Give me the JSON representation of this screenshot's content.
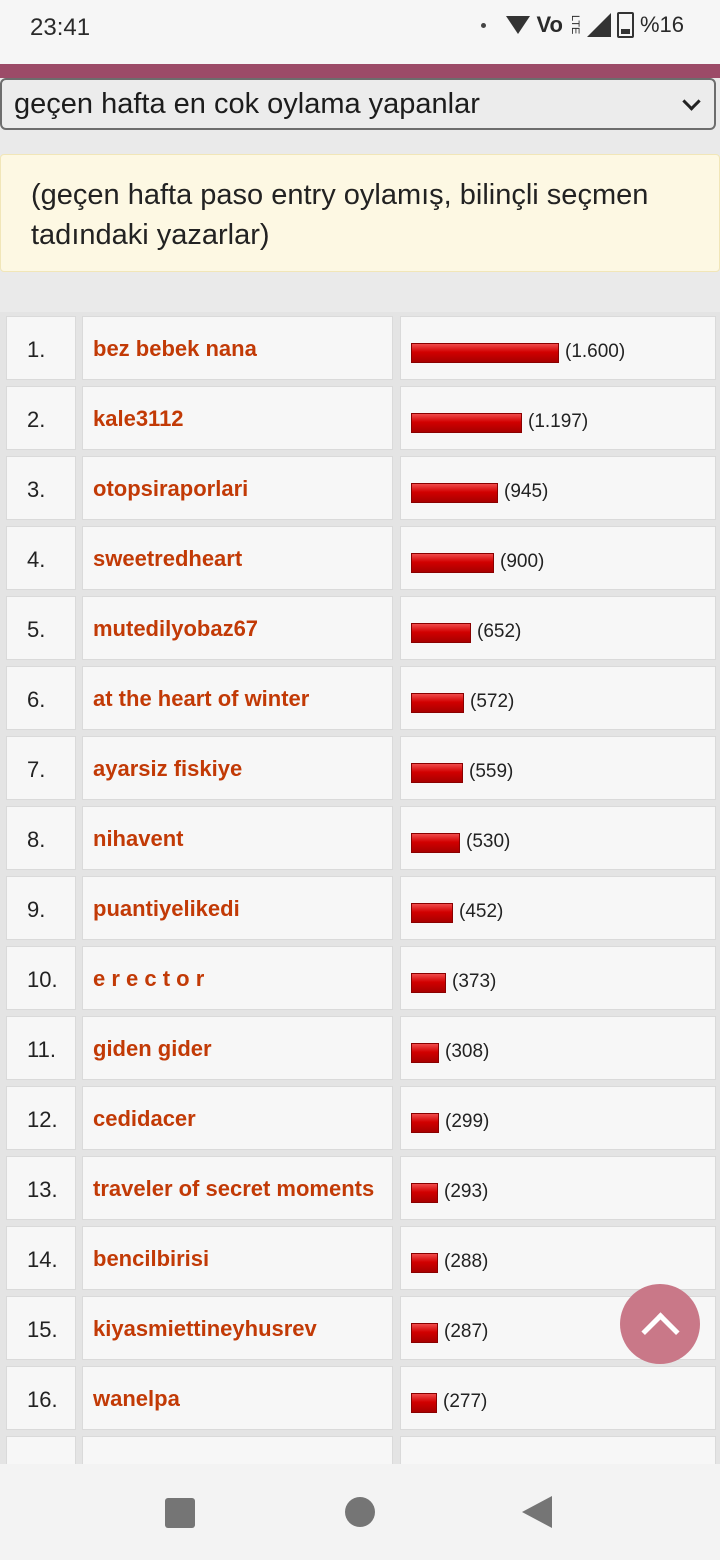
{
  "status": {
    "time": "23:41",
    "battery": "%16",
    "volte": "Vo",
    "lte": "LTE"
  },
  "dropdown": {
    "selected": "geçen hafta en cok oylama yapanlar"
  },
  "info": {
    "text": "(geçen hafta paso entry oylamış, bilinçli seçmen tadındaki yazarlar)"
  },
  "colors": {
    "accent_bar": "#9c4b68",
    "name_color": "#c23a06",
    "bar_red": "#d10000"
  },
  "rows": [
    {
      "rank": "1.",
      "name": "bez bebek nana",
      "count": "(1.600)",
      "value": 1600
    },
    {
      "rank": "2.",
      "name": "kale3112",
      "count": "(1.197)",
      "value": 1197
    },
    {
      "rank": "3.",
      "name": "otopsiraporlari",
      "count": "(945)",
      "value": 945
    },
    {
      "rank": "4.",
      "name": "sweetredheart",
      "count": "(900)",
      "value": 900
    },
    {
      "rank": "5.",
      "name": "mutedilyobaz67",
      "count": "(652)",
      "value": 652
    },
    {
      "rank": "6.",
      "name": "at the heart of winter",
      "count": "(572)",
      "value": 572
    },
    {
      "rank": "7.",
      "name": "ayarsiz fiskiye",
      "count": "(559)",
      "value": 559
    },
    {
      "rank": "8.",
      "name": "nihavent",
      "count": "(530)",
      "value": 530
    },
    {
      "rank": "9.",
      "name": "puantiyelikedi",
      "count": "(452)",
      "value": 452
    },
    {
      "rank": "10.",
      "name": "e r e c t o r",
      "count": "(373)",
      "value": 373
    },
    {
      "rank": "11.",
      "name": "giden gider",
      "count": "(308)",
      "value": 308
    },
    {
      "rank": "12.",
      "name": "cedidacer",
      "count": "(299)",
      "value": 299
    },
    {
      "rank": "13.",
      "name": "traveler of secret moments",
      "count": "(293)",
      "value": 293
    },
    {
      "rank": "14.",
      "name": "bencilbirisi",
      "count": "(288)",
      "value": 288
    },
    {
      "rank": "15.",
      "name": "kiyasmiettineyhusrev",
      "count": "(287)",
      "value": 287
    },
    {
      "rank": "16.",
      "name": "wanelpa",
      "count": "(277)",
      "value": 277
    }
  ],
  "icons": {
    "fab": "chevron-up-icon",
    "nav_recents": "square-icon",
    "nav_home": "circle-icon",
    "nav_back": "back-triangle-icon"
  }
}
